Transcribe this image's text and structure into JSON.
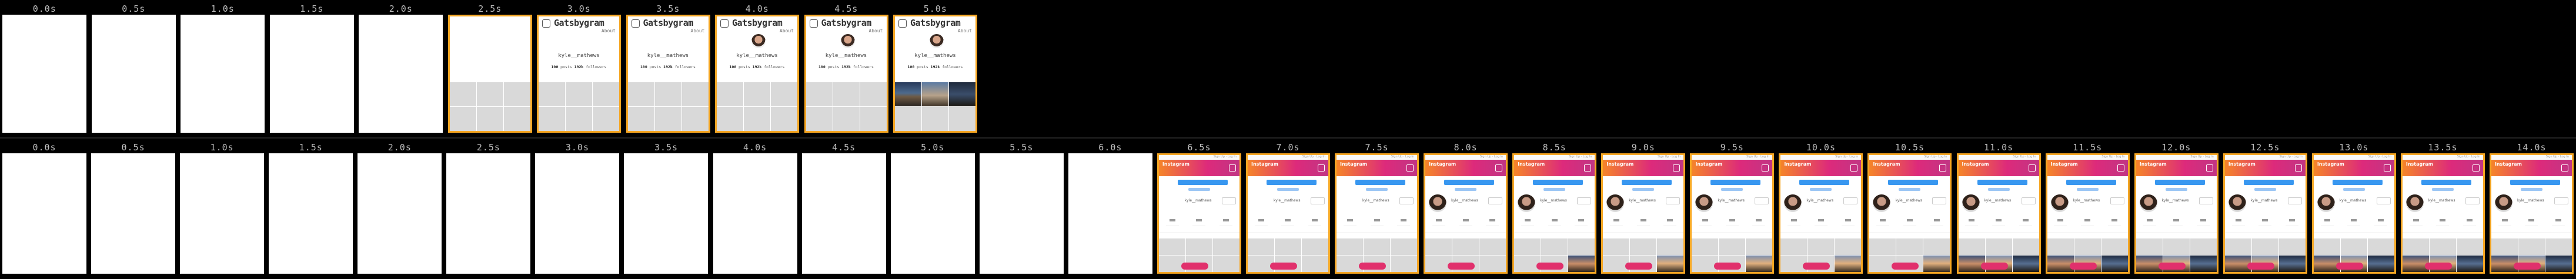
{
  "top_strip": {
    "frames": [
      {
        "time": "0.0s",
        "state": "blank"
      },
      {
        "time": "0.5s",
        "state": "blank"
      },
      {
        "time": "1.0s",
        "state": "blank"
      },
      {
        "time": "1.5s",
        "state": "blank"
      },
      {
        "time": "2.0s",
        "state": "blank"
      },
      {
        "time": "2.5s",
        "state": "header_grid"
      },
      {
        "time": "3.0s",
        "state": "profile_text"
      },
      {
        "time": "3.5s",
        "state": "profile_text"
      },
      {
        "time": "4.0s",
        "state": "profile_avatar"
      },
      {
        "time": "4.5s",
        "state": "profile_avatar"
      },
      {
        "time": "5.0s",
        "state": "profile_photos"
      }
    ],
    "page": {
      "site_title": "Gatsbygram",
      "about_link": "About",
      "username": "kyle__mathews",
      "posts_count": "100",
      "posts_label": "posts",
      "followers_count": "192k",
      "followers_label": "followers"
    }
  },
  "bottom_strip": {
    "frames": [
      {
        "time": "0.0s",
        "state": "blank"
      },
      {
        "time": "0.5s",
        "state": "blank"
      },
      {
        "time": "1.0s",
        "state": "blank"
      },
      {
        "time": "1.5s",
        "state": "blank"
      },
      {
        "time": "2.0s",
        "state": "blank"
      },
      {
        "time": "2.5s",
        "state": "blank"
      },
      {
        "time": "3.0s",
        "state": "blank"
      },
      {
        "time": "3.5s",
        "state": "blank"
      },
      {
        "time": "4.0s",
        "state": "blank"
      },
      {
        "time": "4.5s",
        "state": "blank"
      },
      {
        "time": "5.0s",
        "state": "blank"
      },
      {
        "time": "5.5s",
        "state": "blank"
      },
      {
        "time": "6.0s",
        "state": "blank"
      },
      {
        "time": "6.5s",
        "state": "ig_nopic"
      },
      {
        "time": "7.0s",
        "state": "ig_nopic"
      },
      {
        "time": "7.5s",
        "state": "ig_nopic"
      },
      {
        "time": "8.0s",
        "state": "ig_pic"
      },
      {
        "time": "8.5s",
        "state": "ig_pic_photo"
      },
      {
        "time": "9.0s",
        "state": "ig_pic_photo2"
      },
      {
        "time": "9.5s",
        "state": "ig_pic_photo2"
      },
      {
        "time": "10.0s",
        "state": "ig_pic_photo2"
      },
      {
        "time": "10.5s",
        "state": "ig_pic_photo2"
      },
      {
        "time": "11.0s",
        "state": "ig_pic_photo3"
      },
      {
        "time": "11.5s",
        "state": "ig_pic_photo3"
      },
      {
        "time": "12.0s",
        "state": "ig_pic_photo3"
      },
      {
        "time": "12.5s",
        "state": "ig_pic_photo3"
      },
      {
        "time": "13.0s",
        "state": "ig_pic_photo3"
      },
      {
        "time": "13.5s",
        "state": "ig_pic_photo3"
      },
      {
        "time": "14.0s",
        "state": "ig_pic_photo3"
      }
    ],
    "page": {
      "brand": "Instagram",
      "top_link": "Sign Up · Log In",
      "username": "kyle__mathews"
    }
  },
  "colors": {
    "highlight_border": "#f5a623",
    "background": "#000000",
    "label_text": "#bdbdbd",
    "instagram_gradient": [
      "#f58529",
      "#dd2a7b",
      "#c13584"
    ],
    "instagram_blue": "#3897f0"
  }
}
